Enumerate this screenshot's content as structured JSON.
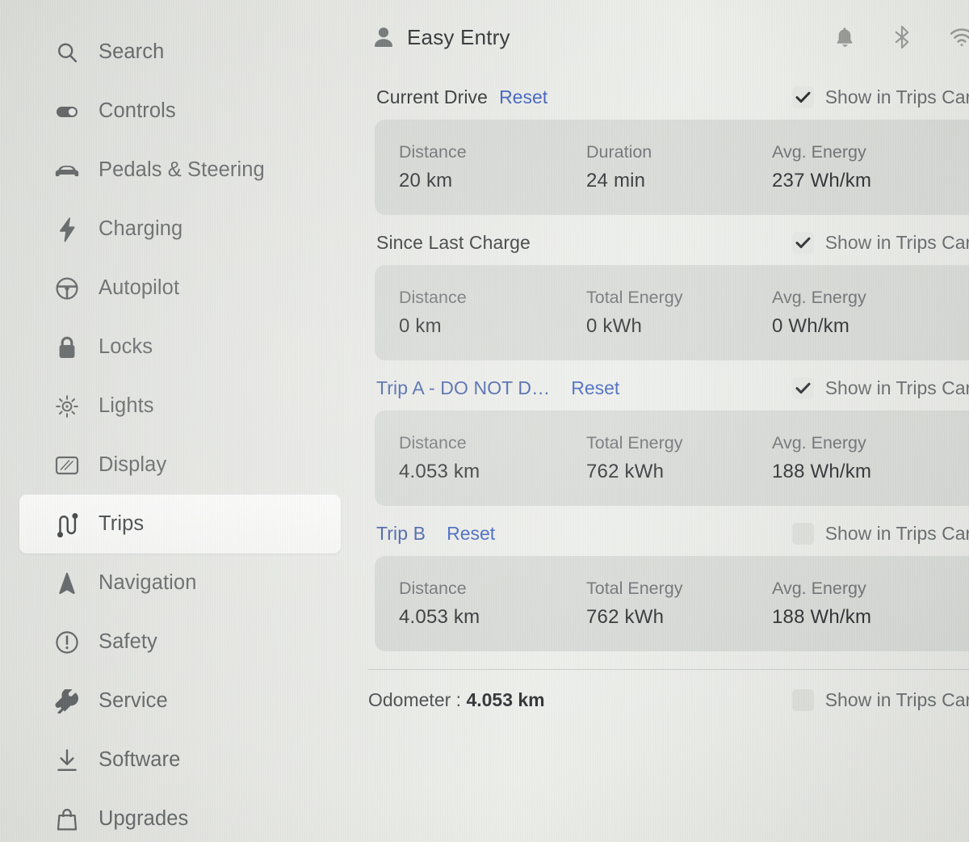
{
  "theme": {
    "background": "#dddedb",
    "link_blue": "#2f55bb",
    "text_dark": "#1d2023",
    "text_muted": "#63666a",
    "card_fill": "#c2c5c1"
  },
  "sidebar": {
    "items": [
      {
        "label": "Search",
        "icon": "search-icon",
        "active": false
      },
      {
        "label": "Controls",
        "icon": "toggle-icon",
        "active": false
      },
      {
        "label": "Pedals & Steering",
        "icon": "car-icon",
        "active": false
      },
      {
        "label": "Charging",
        "icon": "bolt-icon",
        "active": false
      },
      {
        "label": "Autopilot",
        "icon": "steering-icon",
        "active": false
      },
      {
        "label": "Locks",
        "icon": "lock-icon",
        "active": false
      },
      {
        "label": "Lights",
        "icon": "lightbulb-icon",
        "active": false
      },
      {
        "label": "Display",
        "icon": "display-icon",
        "active": false
      },
      {
        "label": "Trips",
        "icon": "route-icon",
        "active": true
      },
      {
        "label": "Navigation",
        "icon": "navigation-icon",
        "active": false
      },
      {
        "label": "Safety",
        "icon": "warning-icon",
        "active": false
      },
      {
        "label": "Service",
        "icon": "wrench-icon",
        "active": false
      },
      {
        "label": "Software",
        "icon": "download-icon",
        "active": false
      },
      {
        "label": "Upgrades",
        "icon": "bag-icon",
        "active": false
      }
    ]
  },
  "topbar": {
    "profile_icon": "person-icon",
    "profile_name": "Easy Entry",
    "status_icons": [
      {
        "name": "bell-icon"
      },
      {
        "name": "bluetooth-icon"
      },
      {
        "name": "wifi-icon"
      }
    ]
  },
  "main": {
    "show_in_trips_label": "Show in Trips Card",
    "sections": [
      {
        "title": "Current Drive",
        "title_is_link": false,
        "reset_label": "Reset",
        "has_reset": true,
        "checked": true,
        "stats": [
          {
            "label": "Distance",
            "value": "20 km"
          },
          {
            "label": "Duration",
            "value": "24 min"
          },
          {
            "label": "Avg. Energy",
            "value": "237 Wh/km"
          }
        ]
      },
      {
        "title": "Since Last Charge",
        "title_is_link": false,
        "reset_label": "",
        "has_reset": false,
        "checked": true,
        "stats": [
          {
            "label": "Distance",
            "value": "0 km"
          },
          {
            "label": "Total Energy",
            "value": "0 kWh"
          },
          {
            "label": "Avg. Energy",
            "value": "0 Wh/km"
          }
        ]
      },
      {
        "title": "Trip A - DO NOT D…",
        "title_is_link": true,
        "reset_label": "Reset",
        "has_reset": true,
        "checked": true,
        "stats": [
          {
            "label": "Distance",
            "value": "4.053 km"
          },
          {
            "label": "Total Energy",
            "value": "762 kWh"
          },
          {
            "label": "Avg. Energy",
            "value": "188 Wh/km"
          }
        ]
      },
      {
        "title": "Trip B",
        "title_is_link": true,
        "reset_label": "Reset",
        "has_reset": true,
        "checked": false,
        "stats": [
          {
            "label": "Distance",
            "value": "4.053 km"
          },
          {
            "label": "Total Energy",
            "value": "762 kWh"
          },
          {
            "label": "Avg. Energy",
            "value": "188 Wh/km"
          }
        ]
      }
    ],
    "odometer": {
      "label": "Odometer :",
      "value": "4.053 km",
      "checked": false
    }
  }
}
